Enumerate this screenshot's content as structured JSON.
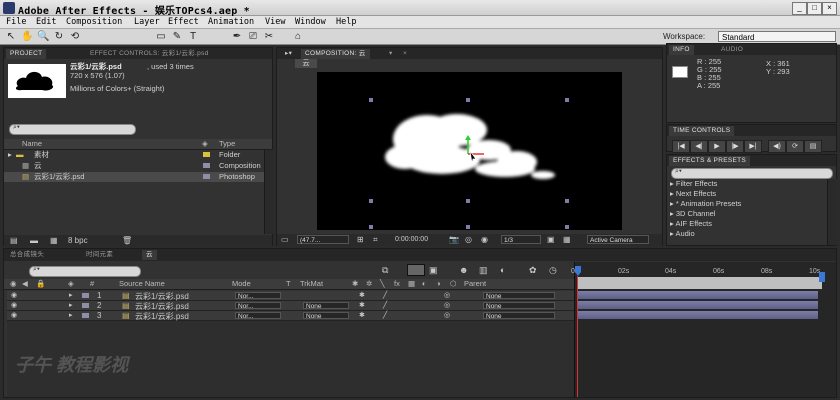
{
  "window": {
    "title": "Adobe After Effects - 娱乐TOPcs4.aep *",
    "min": "_",
    "max": "□",
    "close": "×"
  },
  "menu": [
    "File",
    "Edit",
    "Composition",
    "Layer",
    "Effect",
    "Animation",
    "View",
    "Window",
    "Help"
  ],
  "toolbar": {
    "workspace_label": "Workspace:",
    "workspace_value": "Standard",
    "tool_icons": [
      "↖",
      "✋",
      "🔍",
      "↻",
      "⟲",
      "▭",
      "✎",
      "T",
      "✒",
      "⎚",
      "✂",
      "⌂"
    ]
  },
  "project": {
    "tabs": [
      "PROJECT",
      "EFFECT CONTROLS: 云彩1/云彩.psd"
    ],
    "preview": {
      "name": "云彩1/云彩.psd",
      "used": ", used 3 times",
      "size": "720 x 576 (1.07)",
      "colors": "Millions of Colors+ (Straight)"
    },
    "search_placeholder": "",
    "columns": {
      "name": "Name",
      "type": "Type"
    },
    "items": [
      {
        "name": "素材",
        "type": "Folder",
        "color": "#d8c23a"
      },
      {
        "name": "云",
        "type": "Composition",
        "color": "#8e8ea8"
      },
      {
        "name": "云彩1/云彩.psd",
        "type": "Photoshop",
        "color": "#8e8ea8"
      }
    ],
    "bpc": "8 bpc"
  },
  "composition": {
    "tab": "COMPOSITION: 云",
    "crumb": "云",
    "zoom": "(47.7...",
    "timecode": "0:00:00:00",
    "resolution": "1/3",
    "camera": "Active Camera"
  },
  "info": {
    "tabs": [
      "INFO",
      "AUDIO"
    ],
    "R": "R : 255",
    "G": "G : 255",
    "B": "B : 255",
    "A": "A : 255",
    "X": "X : 361",
    "Y": "Y : 293"
  },
  "time_controls": {
    "tab": "TIME CONTROLS",
    "buttons": [
      "|◀",
      "◀|",
      "▶",
      "|▶",
      "▶|",
      "◀)",
      "⟳",
      "▤"
    ]
  },
  "effects": {
    "tab": "EFFECTS & PRESETS",
    "items": [
      "Filter Effects",
      "Next Effects",
      "* Animation Presets",
      "3D Channel",
      "AIF Effects",
      "Audio"
    ]
  },
  "timeline": {
    "tabs": [
      "总合成镜头",
      "时间元素",
      "云"
    ],
    "columns": {
      "source": "Source Name",
      "mode": "Mode",
      "t": "T",
      "trkmat": "TrkMat",
      "parent": "Parent"
    },
    "layers": [
      {
        "num": "1",
        "name": "云彩1/云彩.psd",
        "mode": "Nor...",
        "trkmat": "",
        "parent": "None"
      },
      {
        "num": "2",
        "name": "云彩1/云彩.psd",
        "mode": "Nor...",
        "trkmat": "None",
        "parent": "None"
      },
      {
        "num": "3",
        "name": "云彩1/云彩.psd",
        "mode": "Nor...",
        "trkmat": "None",
        "parent": "None"
      }
    ],
    "ruler": [
      "0s",
      "02s",
      "04s",
      "06s",
      "08s",
      "10s"
    ]
  },
  "watermark": "子午 教程影视"
}
